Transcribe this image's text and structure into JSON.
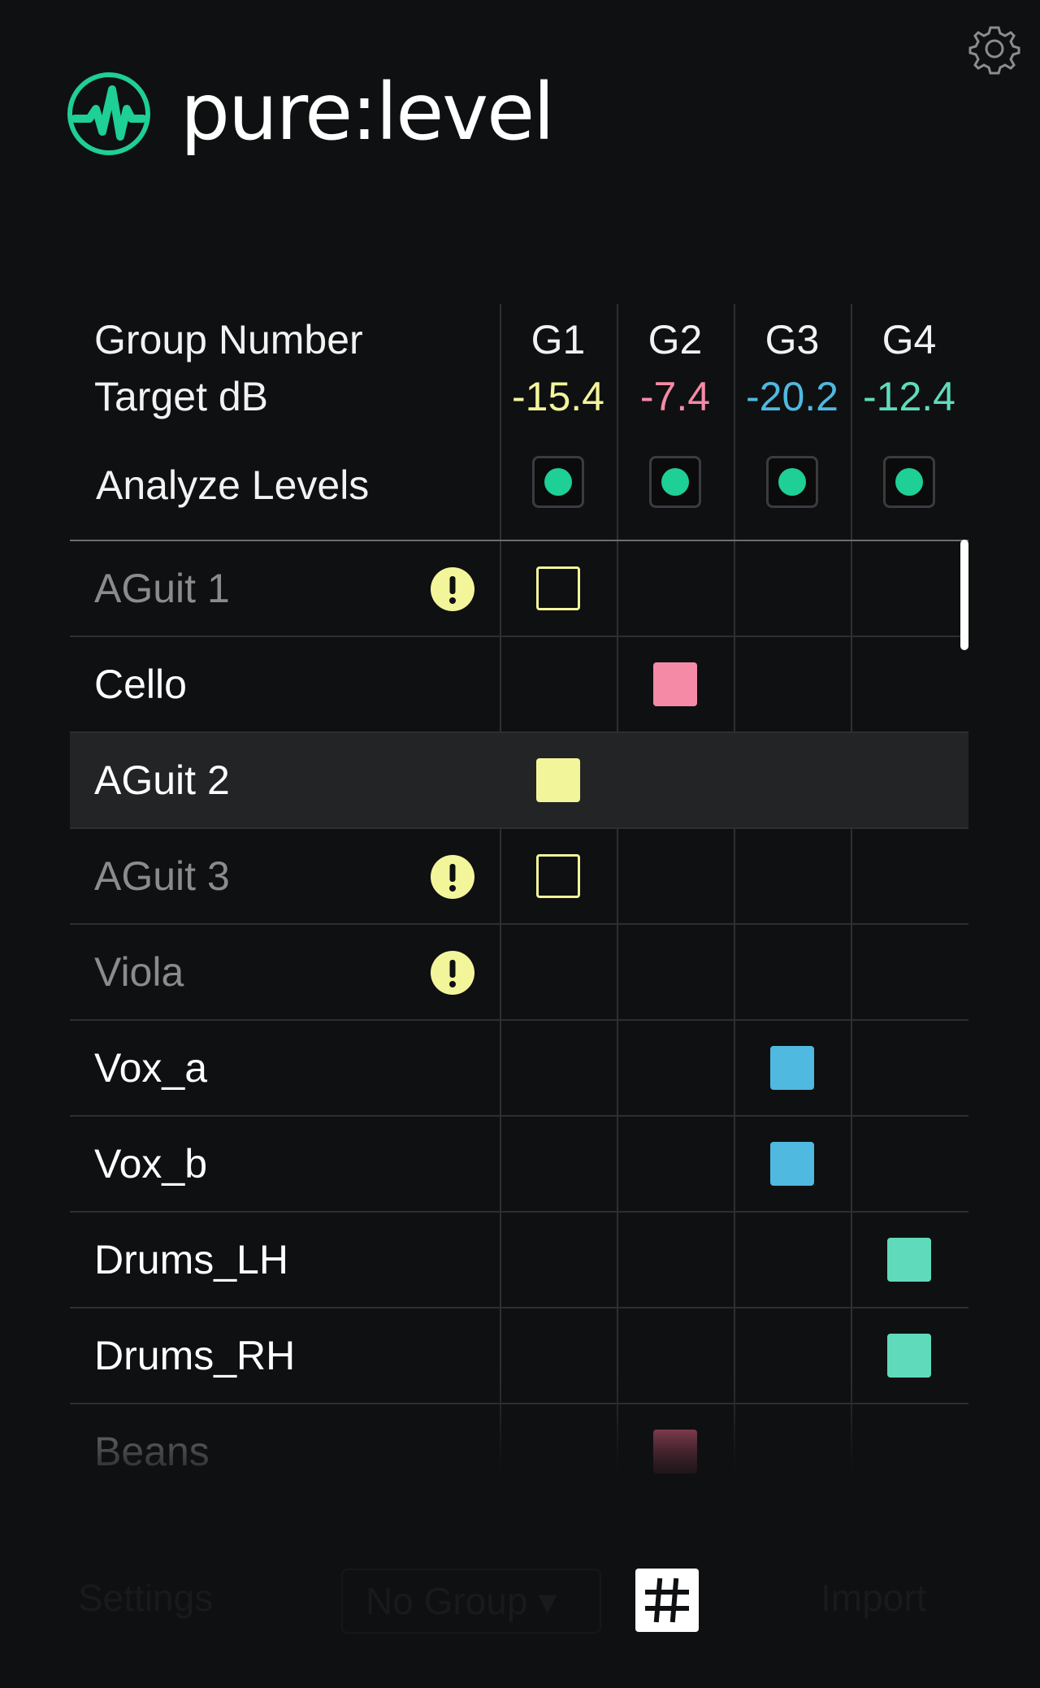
{
  "app": {
    "brand_left": "pure",
    "brand_colon": ":",
    "brand_right": "level",
    "accent": "#1ecf96",
    "icons": {
      "settings": "gear-icon",
      "logo": "waveform-logo-icon"
    }
  },
  "header": {
    "group_number_label": "Group Number",
    "target_db_label": "Target dB",
    "analyze_label": "Analyze Levels"
  },
  "groups": [
    {
      "name": "G1",
      "target": "-15.4",
      "color": "#f3f59b"
    },
    {
      "name": "G2",
      "target": "-7.4",
      "color": "#f58aa7"
    },
    {
      "name": "G3",
      "target": "-20.2",
      "color": "#4fb9e0"
    },
    {
      "name": "G4",
      "target": "-12.4",
      "color": "#5fdbbc"
    }
  ],
  "analyze_dot_color": "#1ecf96",
  "tracks": [
    {
      "name": "AGuit 1",
      "dim": true,
      "warning": true,
      "group": 0,
      "assigned": false
    },
    {
      "name": "Cello",
      "dim": false,
      "warning": false,
      "group": 1,
      "assigned": true
    },
    {
      "name": "AGuit 2",
      "dim": false,
      "warning": false,
      "group": 0,
      "assigned": true,
      "highlight": true
    },
    {
      "name": "AGuit 3",
      "dim": true,
      "warning": true,
      "group": 0,
      "assigned": false
    },
    {
      "name": "Viola",
      "dim": true,
      "warning": true,
      "group": -1,
      "assigned": false
    },
    {
      "name": "Vox_a",
      "dim": false,
      "warning": false,
      "group": 2,
      "assigned": true
    },
    {
      "name": "Vox_b",
      "dim": false,
      "warning": false,
      "group": 2,
      "assigned": true
    },
    {
      "name": "Drums_LH",
      "dim": false,
      "warning": false,
      "group": 3,
      "assigned": true
    },
    {
      "name": "Drums_RH",
      "dim": false,
      "warning": false,
      "group": 3,
      "assigned": true
    },
    {
      "name": "Beans",
      "dim": true,
      "warning": false,
      "group": 1,
      "assigned": true,
      "faded": true
    }
  ],
  "toolbar": {
    "left_label": "Settings",
    "no_group_label": "No Group ▾",
    "right_label": "Import",
    "grid_icon": "hash-grid-icon"
  }
}
